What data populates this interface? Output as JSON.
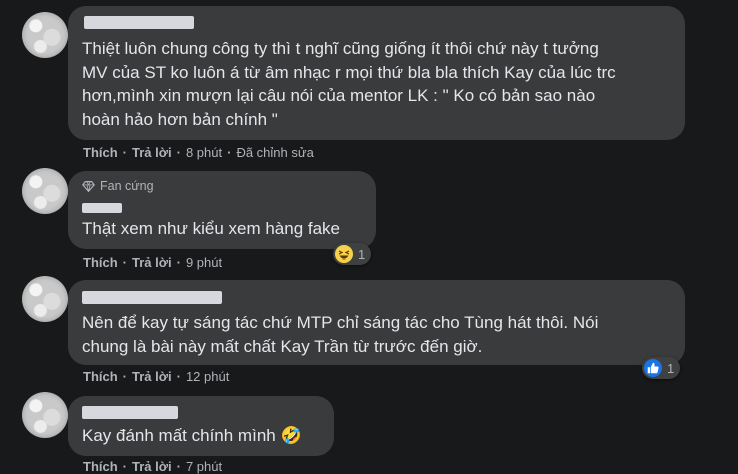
{
  "comments": [
    {
      "lines": [
        "Thiệt luôn chung công ty thì t nghĩ cũng giống ít thôi chứ này t tưởng",
        "MV của ST ko luôn á từ âm nhạc r mọi thứ bla bla thích Kay của lúc trc",
        "hơn,mình xin mượn lại câu nói của mentor LK : \" Ko có bản sao nào",
        "hoàn hảo hơn bản chính \""
      ],
      "like_label": "Thích",
      "reply_label": "Trả lời",
      "time": "8 phút",
      "edited": "Đã chỉnh sửa"
    },
    {
      "badge": "Fan cứng",
      "lines": [
        "Thật xem như kiểu xem hàng fake"
      ],
      "like_label": "Thích",
      "reply_label": "Trả lời",
      "time": "9 phút",
      "reaction_icon": "haha-emoji-icon",
      "reaction_count": "1"
    },
    {
      "lines": [
        "Nên để kay tự sáng tác chứ MTP chỉ sáng tác cho Tùng hát thôi. Nói",
        "chung là bài này mất chất Kay Trần từ trước đến giờ."
      ],
      "like_label": "Thích",
      "reply_label": "Trả lời",
      "time": "12 phút",
      "reaction_icon": "like-thumb-icon",
      "reaction_count": "1"
    },
    {
      "lines": [
        "Kay đánh mất chính mình 🤣"
      ],
      "like_label": "Thích",
      "reply_label": "Trả lời",
      "time": "7 phút"
    }
  ],
  "colors": {
    "background": "#18191a",
    "bubble": "#3a3b3c",
    "text": "#e4e6eb",
    "secondary": "#b0b3b8",
    "like_blue": "#1b74e4",
    "haha_yellow": "#f7d14a"
  }
}
